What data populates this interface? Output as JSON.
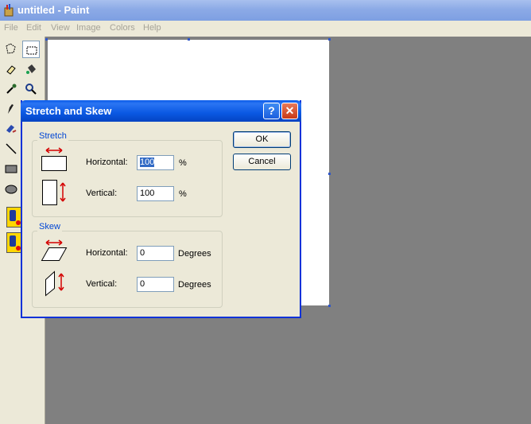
{
  "app": {
    "title": "untitled - Paint"
  },
  "menu": [
    "File",
    "Edit",
    "View",
    "Image",
    "Colors",
    "Help"
  ],
  "dialog": {
    "title": "Stretch and Skew",
    "help_glyph": "?",
    "close_glyph": "✕",
    "ok_label": "OK",
    "cancel_label": "Cancel",
    "stretch": {
      "label": "Stretch",
      "horizontal_label": "Horizontal:",
      "horizontal_value": "100",
      "horizontal_unit": "%",
      "vertical_label": "Vertical:",
      "vertical_value": "100",
      "vertical_unit": "%"
    },
    "skew": {
      "label": "Skew",
      "horizontal_label": "Horizontal:",
      "horizontal_value": "0",
      "horizontal_unit": "Degrees",
      "vertical_label": "Vertical:",
      "vertical_value": "0",
      "vertical_unit": "Degrees"
    }
  },
  "colors": {
    "accent": "#0831d9",
    "arrow": "#d40000",
    "group_label": "#0046d5"
  }
}
